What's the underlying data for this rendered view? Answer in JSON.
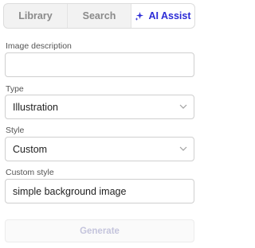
{
  "tabs": {
    "library": "Library",
    "search": "Search",
    "ai_assist": "AI Assist"
  },
  "form": {
    "description_label": "Image description",
    "description_value": "",
    "type_label": "Type",
    "type_value": "Illustration",
    "style_label": "Style",
    "style_value": "Custom",
    "custom_style_label": "Custom style",
    "custom_style_value": "simple background image",
    "generate_label": "Generate"
  },
  "colors": {
    "accent": "#2b2bd6",
    "disabled_text": "#c4c4dc"
  }
}
